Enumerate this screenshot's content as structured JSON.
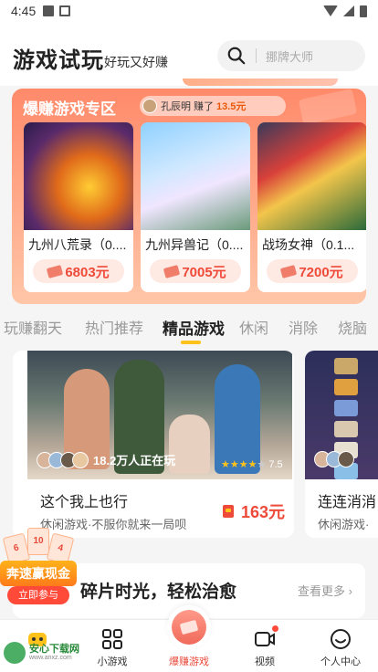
{
  "status": {
    "time": "4:45"
  },
  "header": {
    "title": "游戏试玩",
    "subtitle": "好玩又好赚",
    "search_placeholder": "挪牌大师"
  },
  "zone": {
    "title": "爆赚游戏专区",
    "winner": {
      "name": "孔辰明",
      "text": "赚了",
      "amount": "13.5元"
    },
    "games": [
      {
        "name": "九州八荒录（0....",
        "reward": "6803元"
      },
      {
        "name": "九州异兽记（0....",
        "reward": "7005元"
      },
      {
        "name": "战场女神（0.1...",
        "reward": "7200元"
      }
    ]
  },
  "tabs": [
    "玩赚翻天",
    "热门推荐",
    "精品游戏",
    "休闲",
    "消除",
    "烧脑"
  ],
  "featured": [
    {
      "players": "18.2万人正在玩",
      "rating": "7.5",
      "name": "这个我上也行",
      "desc": "休闲游戏·不服你就来一局呗",
      "reward": "163元"
    },
    {
      "name": "连连消消",
      "desc": "休闲游戏·"
    }
  ],
  "section": {
    "title": "碎片时光，轻松治愈",
    "more": "查看更多 ›"
  },
  "promo": {
    "cards": [
      "6",
      "10",
      "4"
    ],
    "title": "奔速赢现金",
    "join": "立即参与"
  },
  "bottom_nav": [
    {
      "label": ""
    },
    {
      "label": "小游戏"
    },
    {
      "label": "爆赚游戏"
    },
    {
      "label": "视频"
    },
    {
      "label": "个人中心"
    }
  ],
  "watermark": {
    "text": "安心下载网",
    "url": "www.anxz.com"
  }
}
